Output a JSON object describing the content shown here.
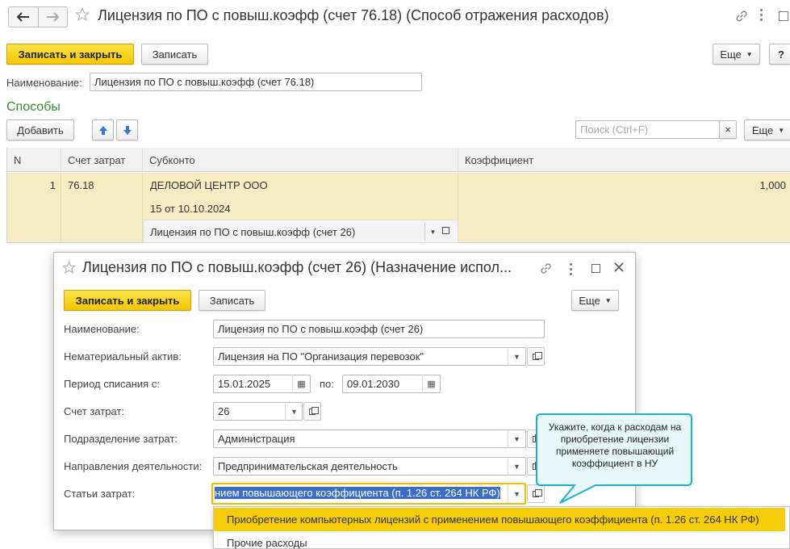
{
  "main": {
    "title": "Лицензия по ПО с повыш.коэфф (счет 76.18) (Способ отражения расходов)",
    "save_close": "Записать и закрыть",
    "save": "Записать",
    "more": "Еще",
    "help": "?",
    "name_label": "Наименование:",
    "name_value": "Лицензия по ПО с повыш.коэфф (счет 76.18)",
    "section_title": "Способы",
    "add": "Добавить",
    "search_placeholder": "Поиск (Ctrl+F)",
    "clear": "×",
    "table": {
      "headers": [
        "N",
        "Счет затрат",
        "Субконто",
        "Коэффициент"
      ],
      "row": {
        "n": "1",
        "account": "76.18",
        "subconto1": "ДЕЛОВОЙ ЦЕНТР ООО",
        "subconto2": "15 от 10.10.2024",
        "subconto3": "Лицензия по ПО с повыш.коэфф (счет 26)",
        "coef": "1,000"
      }
    }
  },
  "dialog": {
    "title": "Лицензия по ПО с повыш.коэфф (счет 26) (Назначение испол...",
    "save_close": "Записать и закрыть",
    "save": "Записать",
    "more": "Еще",
    "fields": {
      "name_label": "Наименование:",
      "name_value": "Лицензия по ПО с повыш.коэфф (счет 26)",
      "asset_label": "Нематериальный актив:",
      "asset_value": "Лицензия на ПО \"Организация перевозок\"",
      "period_label": "Период списания с:",
      "period_from": "15.01.2025",
      "period_to_label": "по:",
      "period_to": "09.01.2030",
      "account_label": "Счет затрат:",
      "account_value": "26",
      "dept_label": "Подразделение затрат:",
      "dept_value": "Администрация",
      "activity_label": "Направления деятельности:",
      "activity_value": "Предпринимательская деятельность",
      "expense_label": "Статьи затрат:",
      "expense_value": "нием повышающего коэффициента (п. 1.26 ст. 264 НК РФ)"
    },
    "dropdown": [
      "Приобретение компьютерных лицензий с применением повышающего коэффициента (п. 1.26 ст. 264 НК РФ)",
      "Прочие расходы"
    ]
  },
  "tooltip": "Укажите, когда к расходам на приобретение лицензии применяете повышающий коэффициент в НУ",
  "colors": {
    "accent_yellow": "#f5cc0a",
    "selected_row": "#f7ebc4",
    "section_green": "#3a8a3a",
    "tooltip_bg": "#e9f9fb",
    "tooltip_border": "#1cb1c9",
    "selection_blue": "#3b6ec8"
  }
}
